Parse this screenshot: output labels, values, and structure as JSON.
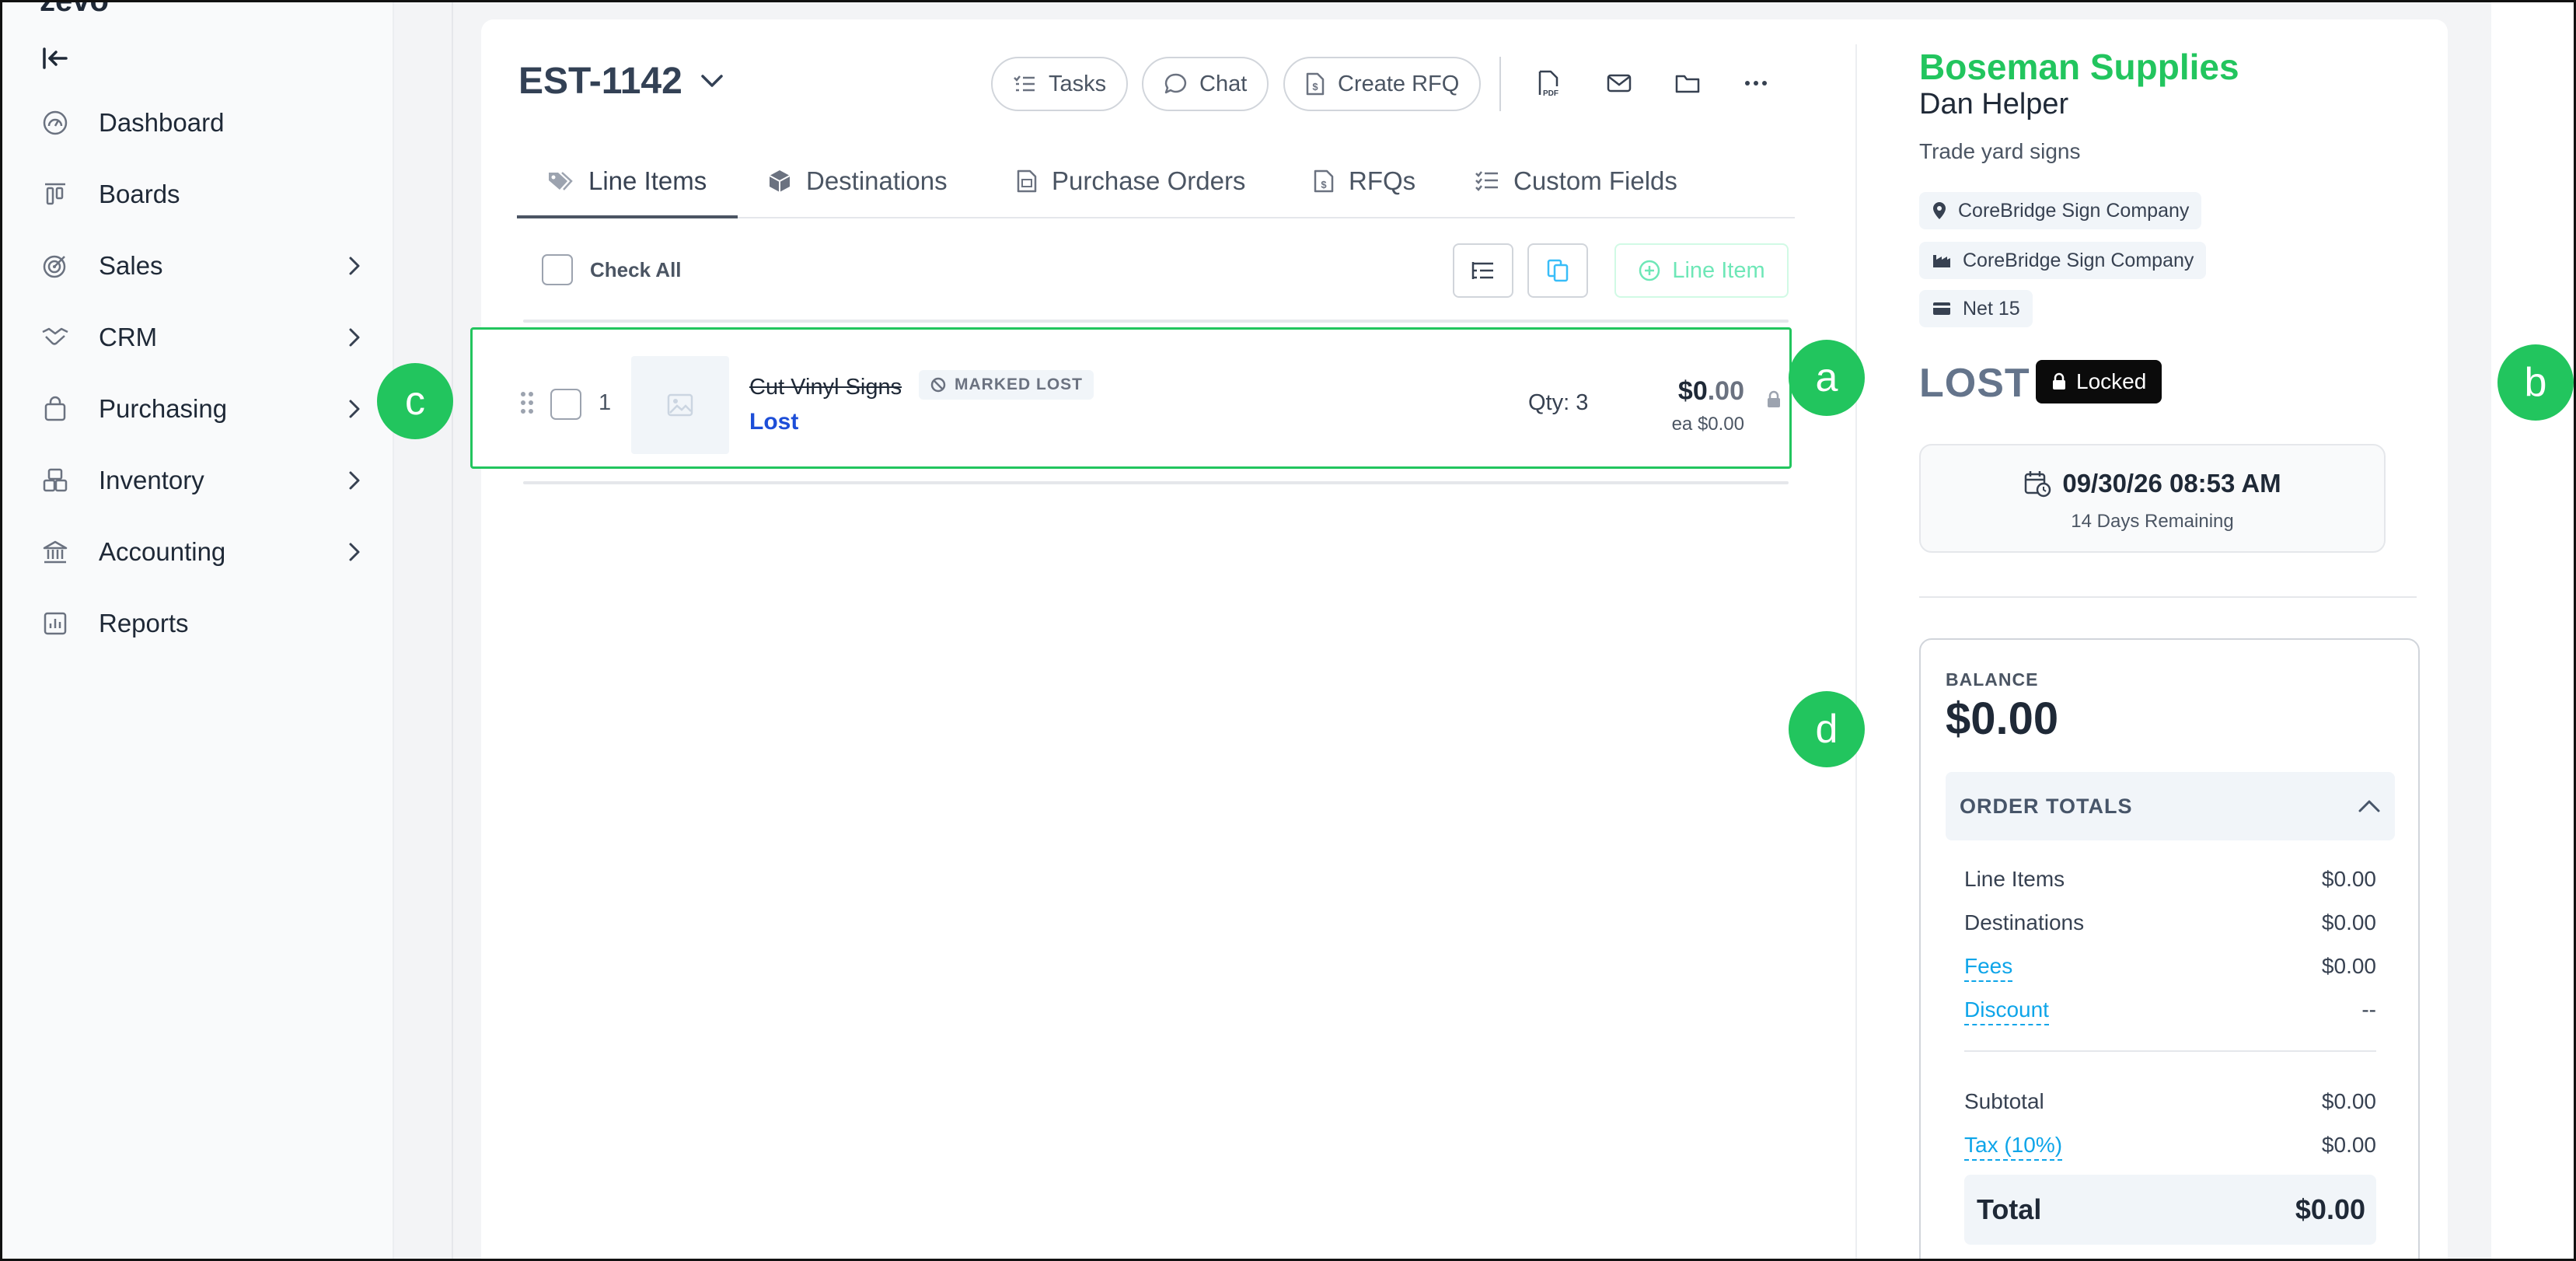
{
  "sidebar": {
    "logo": "zevo",
    "items": [
      {
        "label": "Dashboard",
        "icon": "dashboard-icon",
        "has_children": false
      },
      {
        "label": "Boards",
        "icon": "boards-icon",
        "has_children": false
      },
      {
        "label": "Sales",
        "icon": "sales-icon",
        "has_children": true
      },
      {
        "label": "CRM",
        "icon": "crm-icon",
        "has_children": true
      },
      {
        "label": "Purchasing",
        "icon": "purchasing-icon",
        "has_children": true
      },
      {
        "label": "Inventory",
        "icon": "inventory-icon",
        "has_children": true
      },
      {
        "label": "Accounting",
        "icon": "accounting-icon",
        "has_children": true
      },
      {
        "label": "Reports",
        "icon": "reports-icon",
        "has_children": false
      }
    ]
  },
  "header": {
    "estimate_id": "EST-1142",
    "buttons": {
      "tasks": "Tasks",
      "chat": "Chat",
      "create_rfq": "Create RFQ"
    },
    "tool_icons": [
      "pdf-icon",
      "mail-icon",
      "folder-icon",
      "more-icon"
    ]
  },
  "tabs": [
    {
      "label": "Line Items",
      "active": true
    },
    {
      "label": "Destinations",
      "active": false
    },
    {
      "label": "Purchase Orders",
      "active": false
    },
    {
      "label": "RFQs",
      "active": false
    },
    {
      "label": "Custom Fields",
      "active": false
    }
  ],
  "list_toolbar": {
    "check_all": "Check All",
    "add_line_item": "Line Item"
  },
  "line_item": {
    "number": "1",
    "name": "Cut Vinyl Signs",
    "badge": "MARKED LOST",
    "status": "Lost",
    "qty": "Qty: 3",
    "price_dollars": "$0",
    "price_cents": ".00",
    "price_each": "ea $0.00"
  },
  "callouts": {
    "a": "a",
    "b": "b",
    "c": "c",
    "d": "d"
  },
  "panel": {
    "customer": "Boseman Supplies",
    "contact": "Dan Helper",
    "project": "Trade yard signs",
    "chips": [
      {
        "label": "CoreBridge Sign Company",
        "icon": "location-pin-icon"
      },
      {
        "label": "CoreBridge Sign Company",
        "icon": "factory-icon"
      },
      {
        "label": "Net 15",
        "icon": "card-icon"
      }
    ],
    "status": "LOST",
    "locked": "Locked",
    "due_date": "09/30/26 08:53 AM",
    "days_remaining": "14 Days Remaining",
    "balance_label": "BALANCE",
    "balance_value": "$0.00",
    "order_totals_label": "ORDER TOTALS",
    "totals": {
      "line_items": {
        "label": "Line Items",
        "value": "$0.00"
      },
      "destinations": {
        "label": "Destinations",
        "value": "$0.00"
      },
      "fees": {
        "label": "Fees",
        "value": "$0.00"
      },
      "discount": {
        "label": "Discount",
        "value": "--"
      },
      "subtotal": {
        "label": "Subtotal",
        "value": "$0.00"
      },
      "tax": {
        "label": "Tax (10%)",
        "value": "$0.00"
      },
      "total": {
        "label": "Total",
        "value": "$0.00"
      }
    }
  },
  "colors": {
    "accent_green": "#22c55e",
    "link_blue": "#0ea5e9",
    "status_blue": "#1d4ed8"
  }
}
